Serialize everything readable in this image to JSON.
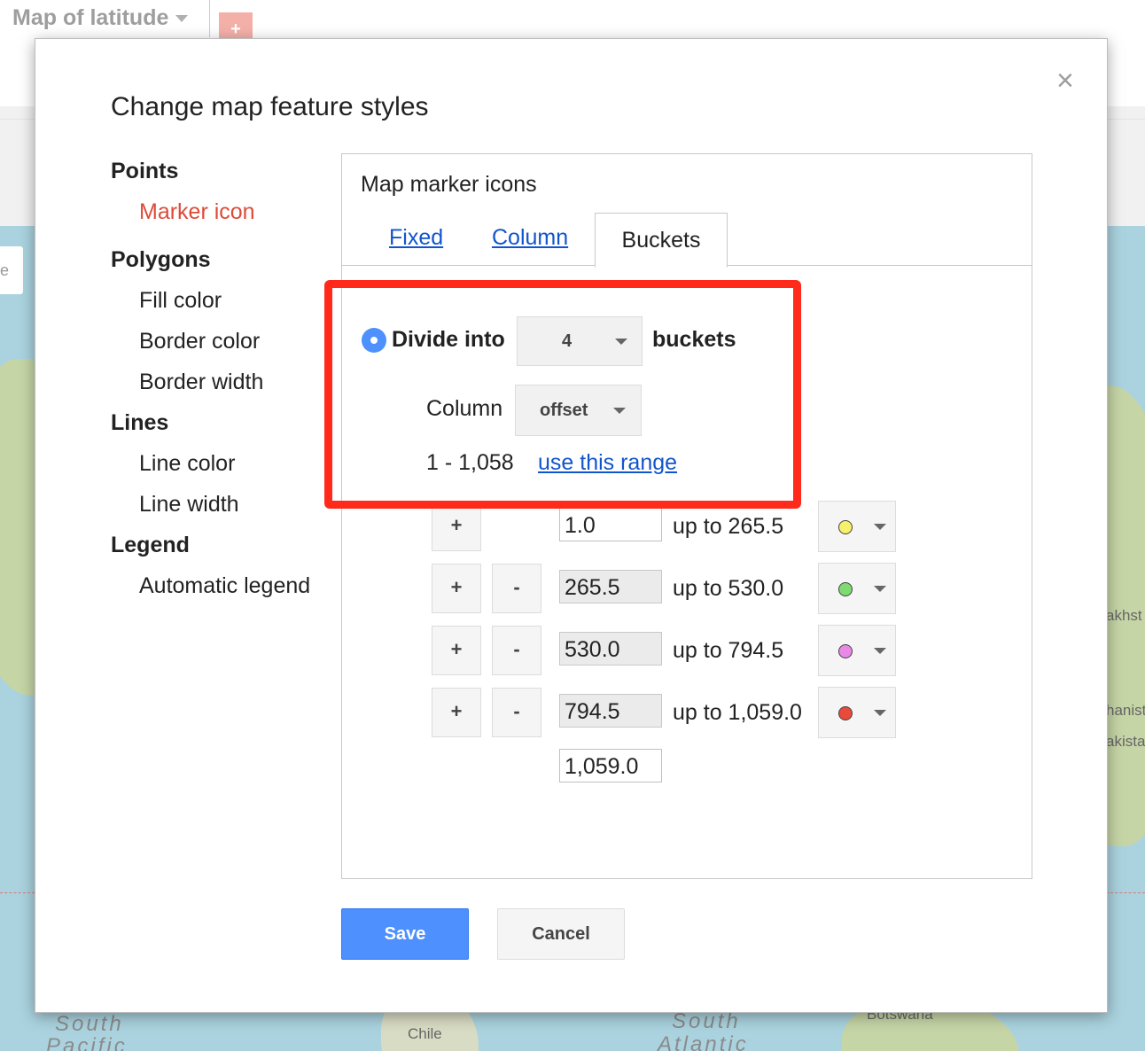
{
  "app": {
    "title": "Map of latitude",
    "add_tab_label": "+"
  },
  "map": {
    "labels": {
      "left_1": "South",
      "left_2": "Pacific",
      "chile": "Chile",
      "mid_1": "South",
      "mid_2": "Atlantic",
      "botswana": "Botswana",
      "r1": "akhst",
      "r2": "hanist",
      "r3": "akista",
      "chip": "e"
    }
  },
  "dialog": {
    "title": "Change map feature styles",
    "close_glyph": "×",
    "nav": {
      "points": {
        "label": "Points",
        "items": [
          "Marker icon"
        ]
      },
      "polygons": {
        "label": "Polygons",
        "items": [
          "Fill color",
          "Border color",
          "Border width"
        ]
      },
      "lines": {
        "label": "Lines",
        "items": [
          "Line color",
          "Line width"
        ]
      },
      "legend": {
        "label": "Legend",
        "items": [
          "Automatic legend"
        ]
      }
    },
    "panel": {
      "heading": "Map marker icons",
      "tabs": [
        "Fixed",
        "Column",
        "Buckets"
      ],
      "divide_label": "Divide into",
      "bucket_count": "4",
      "buckets_label": "buckets",
      "column_label": "Column",
      "column_value": "offset",
      "range_text": "1 - 1,058",
      "use_range_link": "use this range",
      "buckets": [
        {
          "plus": "+",
          "minus": "",
          "from": "1.0",
          "to": "up to 265.5",
          "color": "#f6f06a"
        },
        {
          "plus": "+",
          "minus": "-",
          "from": "265.5",
          "to": "up to 530.0",
          "color": "#7ddb6f"
        },
        {
          "plus": "+",
          "minus": "-",
          "from": "530.0",
          "to": "up to 794.5",
          "color": "#e889e6"
        },
        {
          "plus": "+",
          "minus": "-",
          "from": "794.5",
          "to": "up to 1,059.0",
          "color": "#e84b3c"
        }
      ],
      "final_value": "1,059.0"
    },
    "save_label": "Save",
    "cancel_label": "Cancel"
  },
  "colors": {
    "accent": "#4d90fe",
    "active_nav": "#dd4b39",
    "highlight": "#ff2a1a",
    "link": "#1155cc"
  }
}
